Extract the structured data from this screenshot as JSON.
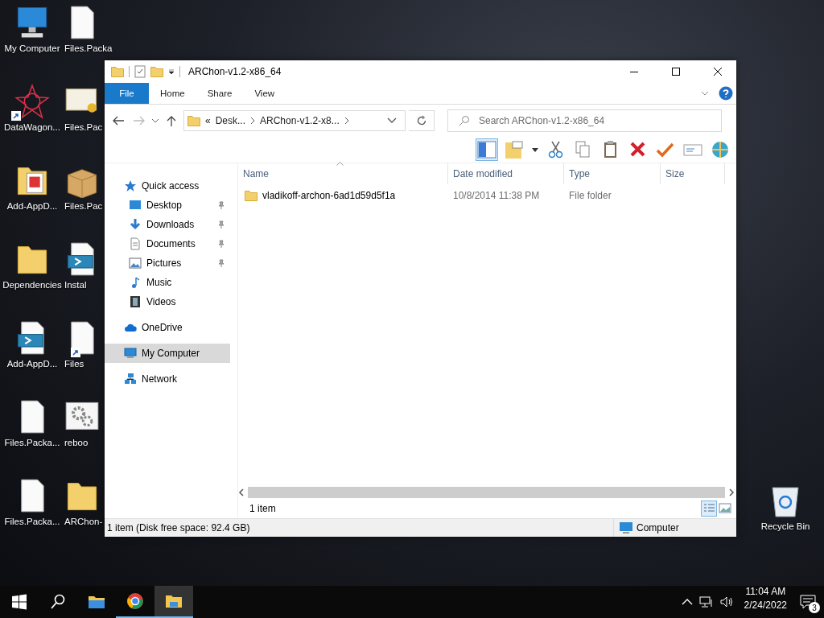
{
  "desktop_icons": [
    {
      "label": "My Computer",
      "kind": "computer",
      "shortcut": false
    },
    {
      "label": "DataWagon...",
      "kind": "star",
      "shortcut": true
    },
    {
      "label": "Add-AppD...",
      "kind": "folder-doc",
      "shortcut": false
    },
    {
      "label": "Dependencies",
      "kind": "folder",
      "shortcut": false
    },
    {
      "label": "Add-AppD...",
      "kind": "script",
      "shortcut": false
    },
    {
      "label": "Files.Packa...",
      "kind": "document",
      "shortcut": false
    },
    {
      "label": "Files.Packa...",
      "kind": "document",
      "shortcut": false
    },
    {
      "label": "Files.Packa",
      "kind": "document",
      "shortcut": false
    },
    {
      "label": "Files.Pac",
      "kind": "certificate",
      "shortcut": false
    },
    {
      "label": "Files.Pac",
      "kind": "box",
      "shortcut": false
    },
    {
      "label": "Instal",
      "kind": "script",
      "shortcut": false
    },
    {
      "label": "Files",
      "kind": "document",
      "shortcut": true
    },
    {
      "label": "reboo",
      "kind": "gears",
      "shortcut": false
    },
    {
      "label": "ARChon-",
      "kind": "folder",
      "shortcut": false
    }
  ],
  "recycle_bin": {
    "label": "Recycle Bin"
  },
  "window": {
    "title": "ARChon-v1.2-x86_64",
    "ribbon_tabs": [
      {
        "label": "File",
        "kind": "file"
      },
      {
        "label": "Home",
        "kind": "tab"
      },
      {
        "label": "Share",
        "kind": "tab"
      },
      {
        "label": "View",
        "kind": "tab"
      }
    ],
    "address": {
      "overflow": "«",
      "segments": [
        "Desk...",
        "ARChon-v1.2-x8..."
      ]
    },
    "search": {
      "placeholder": "Search ARChon-v1.2-x86_64"
    },
    "nav": [
      {
        "label": "Quick access",
        "selected": false,
        "pinned": false,
        "children": [
          {
            "label": "Desktop",
            "selected": false,
            "pinned": true
          },
          {
            "label": "Downloads",
            "selected": false,
            "pinned": true
          },
          {
            "label": "Documents",
            "selected": false,
            "pinned": true
          },
          {
            "label": "Pictures",
            "selected": false,
            "pinned": true
          },
          {
            "label": "Music",
            "selected": false,
            "pinned": false
          },
          {
            "label": "Videos",
            "selected": false,
            "pinned": false
          }
        ]
      },
      {
        "label": "OneDrive",
        "selected": false,
        "pinned": false
      },
      {
        "label": "My Computer",
        "selected": true,
        "pinned": false
      },
      {
        "label": "Network",
        "selected": false,
        "pinned": false
      }
    ],
    "columns": [
      "Name",
      "Date modified",
      "Type",
      "Size"
    ],
    "rows": [
      {
        "name": "vladikoff-archon-6ad1d59d5f1a",
        "date": "10/8/2014 11:38 PM",
        "type": "File folder"
      }
    ],
    "item_count": "1 item",
    "status": {
      "text": "1 item (Disk free space: 92.4 GB)",
      "location": "Computer"
    }
  },
  "taskbar": {
    "apps": [
      {
        "kind": "folder",
        "selected": false,
        "running": false
      },
      {
        "kind": "browser",
        "selected": false,
        "running": true
      },
      {
        "kind": "explorer",
        "selected": true,
        "running": true
      }
    ],
    "time": "11:04 AM",
    "date": "2/24/2022",
    "notifications": "3"
  }
}
